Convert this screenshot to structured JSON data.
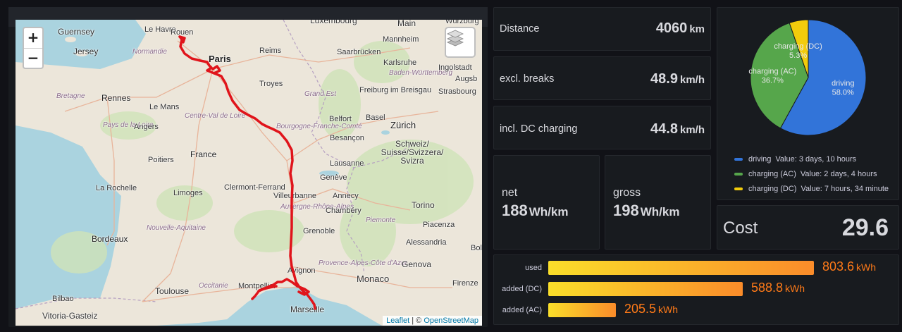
{
  "map": {
    "zoom_in": "+",
    "zoom_out": "−",
    "attribution_leaflet": "Leaflet",
    "attribution_sep": " | © ",
    "attribution_osm": "OpenStreetMap",
    "places": [
      {
        "name": "Guernsey"
      },
      {
        "name": "Jersey"
      },
      {
        "name": "Le Havre"
      },
      {
        "name": "Rouen"
      },
      {
        "name": "Normandie"
      },
      {
        "name": "Paris"
      },
      {
        "name": "Reims"
      },
      {
        "name": "Luxembourg"
      },
      {
        "name": "Main"
      },
      {
        "name": "Würzburg"
      },
      {
        "name": "Mannheim"
      },
      {
        "name": "Saarbrücken"
      },
      {
        "name": "Karlsruhe"
      },
      {
        "name": "Baden-Württemberg"
      },
      {
        "name": "Ingolstadt"
      },
      {
        "name": "Bretagne"
      },
      {
        "name": "Rennes"
      },
      {
        "name": "Troyes"
      },
      {
        "name": "Grand Est"
      },
      {
        "name": "Strasbourg"
      },
      {
        "name": "Freiburg im Breisgau"
      },
      {
        "name": "Le Mans"
      },
      {
        "name": "Pays de la Loire"
      },
      {
        "name": "Angers"
      },
      {
        "name": "Centre-Val de Loire"
      },
      {
        "name": "Belfort"
      },
      {
        "name": "Basel"
      },
      {
        "name": "Zürich"
      },
      {
        "name": "Bourgogne-Franche-Comté"
      },
      {
        "name": "Besançon"
      },
      {
        "name": "Schweiz/ Suisse/Svizzera/ Svizra"
      },
      {
        "name": "France"
      },
      {
        "name": "Poitiers"
      },
      {
        "name": "Lausanne"
      },
      {
        "name": "Genève"
      },
      {
        "name": "La Rochelle"
      },
      {
        "name": "Limoges"
      },
      {
        "name": "Clermont-Ferrand"
      },
      {
        "name": "Villeurbanne"
      },
      {
        "name": "Annecy"
      },
      {
        "name": "Auvergne-Rhône-Alpes"
      },
      {
        "name": "Chambéry"
      },
      {
        "name": "Bordeaux"
      },
      {
        "name": "Nouvelle-Aquitaine"
      },
      {
        "name": "Grenoble"
      },
      {
        "name": "Torino"
      },
      {
        "name": "Piemonte"
      },
      {
        "name": "Piacenza"
      },
      {
        "name": "Alessandria"
      },
      {
        "name": "Provence-Alpes-Côte d'Azur"
      },
      {
        "name": "Genova"
      },
      {
        "name": "Avignon"
      },
      {
        "name": "Monaco"
      },
      {
        "name": "Toulouse"
      },
      {
        "name": "Occitanie"
      },
      {
        "name": "Montpellier"
      },
      {
        "name": "Firenze"
      },
      {
        "name": "Bilbao"
      },
      {
        "name": "Vitoria-Gasteiz"
      },
      {
        "name": "Marseille"
      },
      {
        "name": "Augsb"
      },
      {
        "name": "Bolo"
      }
    ]
  },
  "distance": {
    "label": "Distance",
    "value": "4060",
    "unit": "km"
  },
  "excl_breaks": {
    "label": "excl. breaks",
    "value": "48.9",
    "unit": "km/h"
  },
  "incl_dc": {
    "label": "incl. DC charging",
    "value": "44.8",
    "unit": "km/h"
  },
  "net": {
    "label": "net",
    "value": "188",
    "unit": "Wh/km"
  },
  "gross": {
    "label": "gross",
    "value": "198",
    "unit": "Wh/km"
  },
  "pie": {
    "slices": [
      {
        "name": "driving",
        "pct": "58.0%",
        "value": 58.0,
        "color": "#3274d9",
        "legend_value": "Value: 3 days, 10 hours"
      },
      {
        "name": "charging (AC)",
        "pct": "36.7%",
        "value": 36.7,
        "color": "#56a64b",
        "legend_value": "Value: 2 days, 4 hours"
      },
      {
        "name": "charging (DC)",
        "pct": "5.3%",
        "value": 5.3,
        "color": "#f2cc0c",
        "legend_value": "Value: 7 hours, 34 minute"
      }
    ]
  },
  "cost": {
    "label": "Cost",
    "value": "29.6"
  },
  "bargauge": {
    "max": 803.6,
    "rows": [
      {
        "label": "used",
        "value": 803.6,
        "text": "803.6",
        "unit": "kWh"
      },
      {
        "label": "added (DC)",
        "value": 588.8,
        "text": "588.8",
        "unit": "kWh"
      },
      {
        "label": "added (AC)",
        "value": 205.5,
        "text": "205.5",
        "unit": "kWh"
      }
    ]
  }
}
